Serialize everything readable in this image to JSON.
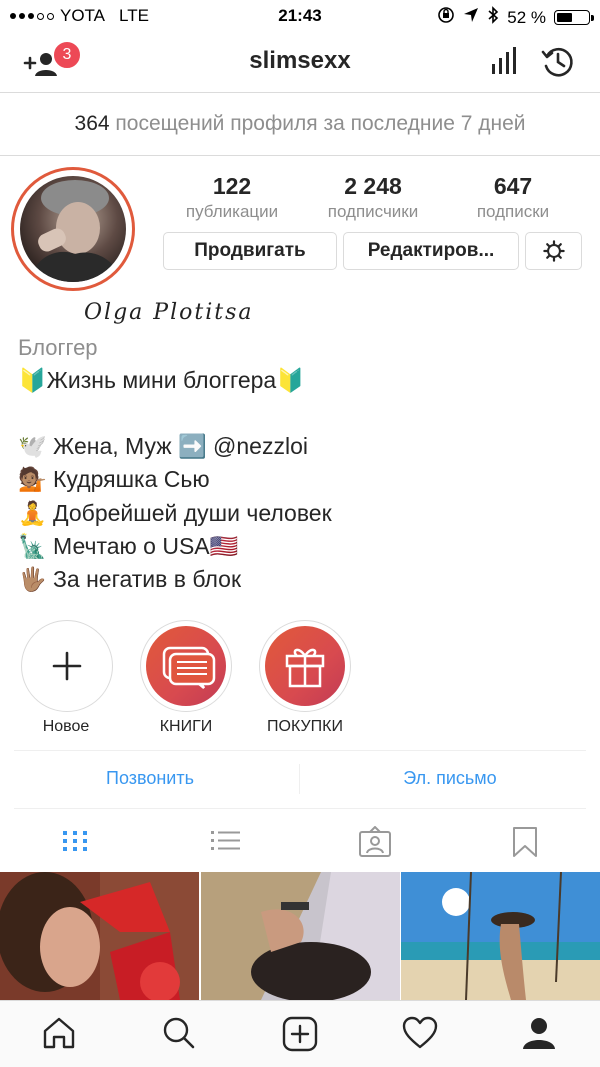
{
  "status_bar": {
    "carrier": "YOTA",
    "network": "LTE",
    "time": "21:43",
    "battery": "52 %",
    "battery_level": 0.52
  },
  "header": {
    "username": "slimsexx",
    "badge_count": "3"
  },
  "visits": {
    "count": "364",
    "text": "посещений профиля за последние 7 дней"
  },
  "stats": [
    {
      "value": "122",
      "label": "публикации"
    },
    {
      "value": "2 248",
      "label": "подписчики"
    },
    {
      "value": "647",
      "label": "подписки"
    }
  ],
  "buttons": {
    "promote": "Продвигать",
    "edit": "Редактиров..."
  },
  "signature": "Olga Plotitsa",
  "bio": {
    "category": "Блоггер",
    "lines": [
      "🔰Жизнь мини блоггера🔰",
      "🕊️ Жена, Муж ➡️ @nezzloi",
      "💁🏽 Кудряшка Сью",
      "🧘 Добрейшей души человек",
      "🗽 Мечтаю о USA🇺🇸",
      "🖐🏽 За негатив в блок"
    ]
  },
  "highlights": [
    {
      "label": "Новое",
      "icon": "plus-icon"
    },
    {
      "label": "КНИГИ",
      "icon": "chat-bubbles-icon"
    },
    {
      "label": "ПОКУПКИ",
      "icon": "gift-icon"
    }
  ],
  "contact": {
    "call": "Позвонить",
    "email": "Эл. письмо"
  },
  "colors": {
    "accent": "#3897f0",
    "badge": "#ed4956",
    "highlight_gradient": "#e15a3a"
  }
}
